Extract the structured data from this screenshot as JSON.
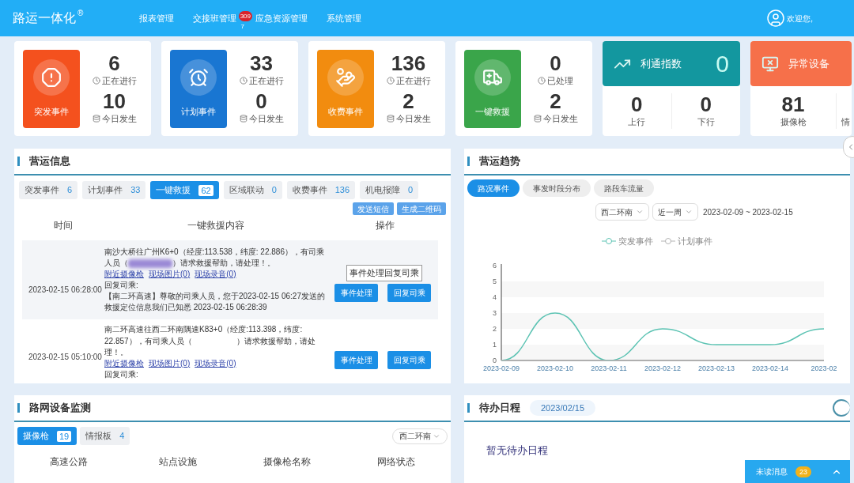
{
  "header": {
    "logo": "路运一体化",
    "logo_mark": "®",
    "nav": [
      {
        "label": "报表管理"
      },
      {
        "label": "交接班管理",
        "badge": "309",
        "badge_overflow": "7"
      },
      {
        "label": "应急资源管理"
      },
      {
        "label": "系统管理"
      }
    ],
    "greeting": "欢迎您,"
  },
  "stat_cards": [
    {
      "kind": "counter",
      "title": "突发事件",
      "color": "#f4511e",
      "top": {
        "value": "6",
        "label": "正在进行"
      },
      "bottom": {
        "value": "10",
        "label": "今日发生"
      }
    },
    {
      "kind": "counter",
      "title": "计划事件",
      "color": "#1976d2",
      "top": {
        "value": "33",
        "label": "正在进行"
      },
      "bottom": {
        "value": "0",
        "label": "今日发生"
      }
    },
    {
      "kind": "counter",
      "title": "收费事件",
      "color": "#f28c0f",
      "top": {
        "value": "136",
        "label": "正在进行"
      },
      "bottom": {
        "value": "2",
        "label": "今日发生"
      }
    },
    {
      "kind": "counter",
      "title": "一键救援",
      "color": "#3aa54a",
      "top": {
        "value": "0",
        "label": "已处理"
      },
      "bottom": {
        "value": "2",
        "label": "今日发生"
      }
    },
    {
      "kind": "index",
      "title": "利通指数",
      "value": "0",
      "color": "#13979f",
      "stats": [
        {
          "value": "0",
          "label": "上行"
        },
        {
          "value": "0",
          "label": "下行"
        }
      ]
    },
    {
      "kind": "index",
      "title": "异常设备",
      "color": "#f6704a",
      "stats": [
        {
          "value": "81",
          "label": "摄像枪"
        },
        {
          "label": "情"
        }
      ]
    }
  ],
  "operations": {
    "title": "营运信息",
    "tabs": [
      {
        "label": "突发事件",
        "count": "6",
        "selected": false
      },
      {
        "label": "计划事件",
        "count": "33",
        "selected": false
      },
      {
        "label": "一键救援",
        "count": "62",
        "selected": true
      },
      {
        "label": "区域联动",
        "count": "0",
        "selected": false
      },
      {
        "label": "收费事件",
        "count": "136",
        "selected": false
      },
      {
        "label": "机电报障",
        "count": "0",
        "selected": false
      }
    ],
    "actions": [
      "发送短信",
      "生成二维码"
    ],
    "columns": [
      "时间",
      "一键救援内容",
      "操作"
    ],
    "rows": [
      {
        "time": "2023-02-15 06:28:00",
        "text_before": "南沙大桥往广州K6+0（经度:113.538，纬度: 22.886），有司乘人员（",
        "kind": "blurred",
        "text_after": "）请求救援帮助，请处理！。",
        "links": [
          "附近摄像枪",
          "现场图片(0)",
          "现场录音(0)"
        ],
        "reply_label": "回复司乘:",
        "reply": "【南二环高速】尊敬的司乘人员，您于2023-02-15 06:27发送的救援定位信息我们已知悉 2023-02-15 06:28:39",
        "buttons": [
          "事件处理",
          "回复司乘"
        ],
        "tooltip": "事件处理回复司乘"
      },
      {
        "time": "2023-02-15 05:10:00",
        "text_before": "南二环高速往西二环南隅速K83+0（经度:113.398，纬度: 22.857），有司乘人员（",
        "kind": "plain",
        "text_after": "）请求救援帮助，请处理！。",
        "links": [
          "附近摄像枪",
          "现场图片(0)",
          "现场录音(0)"
        ],
        "reply_label": "回复司乘:",
        "buttons": [
          "事件处理",
          "回复司乘"
        ]
      }
    ]
  },
  "trend": {
    "title": "营运趋势",
    "tabs": [
      {
        "label": "路况事件",
        "selected": true
      },
      {
        "label": "事发时段分布",
        "selected": false
      },
      {
        "label": "路段车流量",
        "selected": false
      }
    ],
    "filters": [
      "西二环南",
      "近一周"
    ],
    "date_range": "2023-02-09 ~ 2023-02-15",
    "chart_data": {
      "type": "line",
      "categories": [
        "2023-02-09",
        "2023-02-10",
        "2023-02-11",
        "2023-02-12",
        "2023-02-13",
        "2023-02-14",
        "2023-02"
      ],
      "series": [
        {
          "name": "突发事件",
          "color": "#5cc3b3",
          "values": [
            0,
            3,
            0,
            2,
            1,
            1,
            2
          ]
        },
        {
          "name": "计划事件",
          "color": "#b5b5b5",
          "values": [
            0,
            0,
            0,
            0,
            0,
            0,
            0
          ]
        }
      ],
      "legend": "top",
      "ylim": [
        0,
        6
      ],
      "yticks": [
        0,
        1,
        2,
        3,
        4,
        5,
        6
      ]
    }
  },
  "devices": {
    "title": "路网设备监测",
    "tabs": [
      {
        "label": "摄像枪",
        "count": "19",
        "selected": true
      },
      {
        "label": "情报板",
        "count": "4",
        "selected": false
      }
    ],
    "filter": "西二环南",
    "columns": [
      "高速公路",
      "站点设施",
      "摄像枪名称",
      "网络状态"
    ]
  },
  "schedule": {
    "title": "待办日程",
    "date": "2023/02/15",
    "empty_text": "暂无待办日程"
  },
  "unread": {
    "label": "未读消息",
    "count": "23"
  }
}
